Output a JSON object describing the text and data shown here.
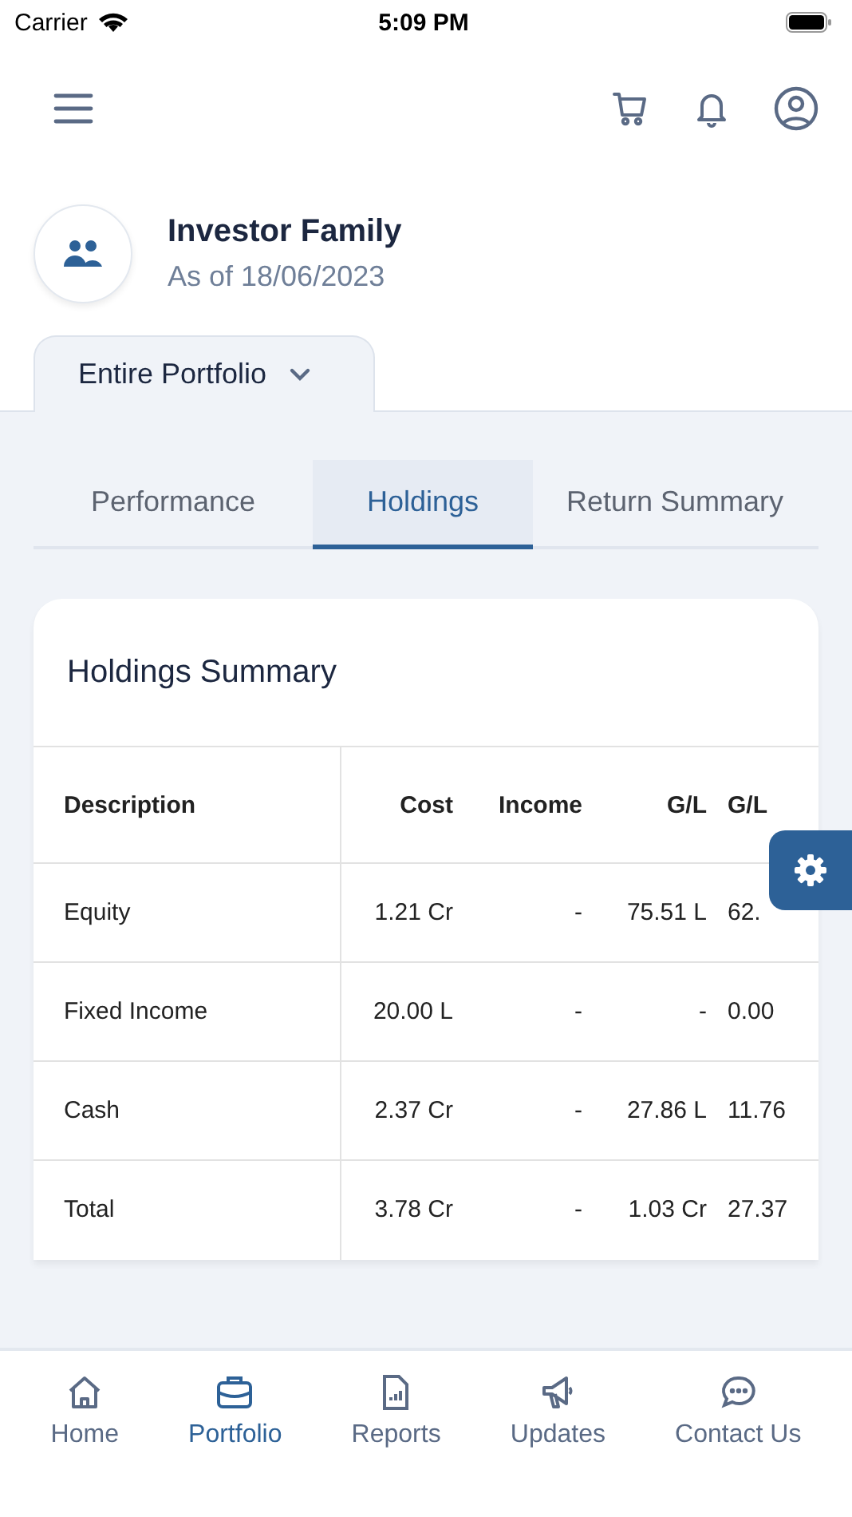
{
  "status_bar": {
    "carrier": "Carrier",
    "time": "5:09 PM"
  },
  "profile": {
    "name": "Investor Family",
    "as_of": "As of 18/06/2023"
  },
  "portfolio_selector": {
    "label": "Entire Portfolio"
  },
  "tabs": [
    {
      "label": "Performance",
      "selected": false
    },
    {
      "label": "Holdings",
      "selected": true
    },
    {
      "label": "Return Summary",
      "selected": false
    }
  ],
  "card": {
    "title": "Holdings Summary",
    "columns": [
      "Description",
      "Cost",
      "Income",
      "G/L",
      "G/L"
    ],
    "rows": [
      [
        "Equity",
        "1.21 Cr",
        "-",
        "75.51 L",
        "62."
      ],
      [
        "Fixed Income",
        "20.00 L",
        "-",
        "-",
        "0.00"
      ],
      [
        "Cash",
        "2.37 Cr",
        "-",
        "27.86 L",
        "11.76"
      ],
      [
        "Total",
        "3.78 Cr",
        "-",
        "1.03 Cr",
        "27.37"
      ]
    ]
  },
  "nav": [
    {
      "label": "Home",
      "selected": false,
      "kind": "home"
    },
    {
      "label": "Portfolio",
      "selected": true,
      "kind": "portfolio"
    },
    {
      "label": "Reports",
      "selected": false,
      "kind": "reports"
    },
    {
      "label": "Updates",
      "selected": false,
      "kind": "updates"
    },
    {
      "label": "Contact Us",
      "selected": false,
      "kind": "contact"
    }
  ]
}
